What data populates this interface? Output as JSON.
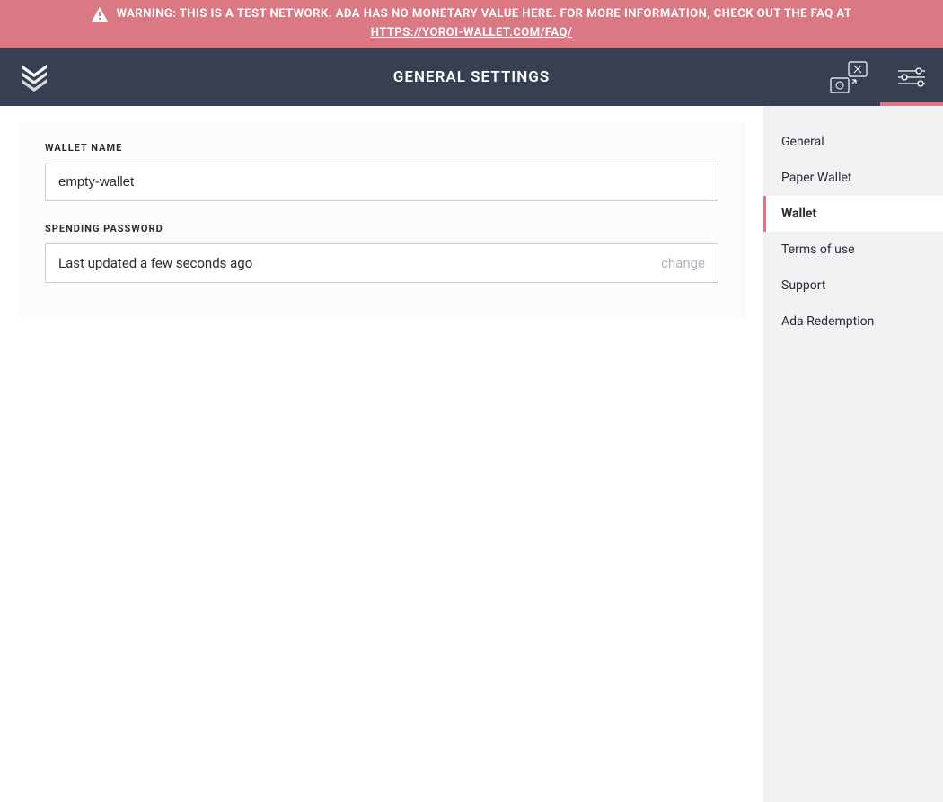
{
  "warning": {
    "prefix": "WARNING: THIS IS A TEST NETWORK. ADA HAS NO MONETARY VALUE HERE. FOR MORE INFORMATION, CHECK OUT THE FAQ AT ",
    "link_text": "HTTPS://YOROI-WALLET.COM/FAQ/"
  },
  "header": {
    "title": "GENERAL SETTINGS"
  },
  "form": {
    "wallet_name_label": "WALLET NAME",
    "wallet_name_value": "empty-wallet",
    "spending_password_label": "SPENDING PASSWORD",
    "password_status": "Last updated a few seconds ago",
    "change_label": "change"
  },
  "sidebar": {
    "items": [
      {
        "label": "General"
      },
      {
        "label": "Paper Wallet"
      },
      {
        "label": "Wallet"
      },
      {
        "label": "Terms of use"
      },
      {
        "label": "Support"
      },
      {
        "label": "Ada Redemption"
      }
    ],
    "active_index": 2
  },
  "colors": {
    "accent": "#da7984",
    "header_bg": "#373f52",
    "sidebar_bg": "#f1f2f4"
  }
}
